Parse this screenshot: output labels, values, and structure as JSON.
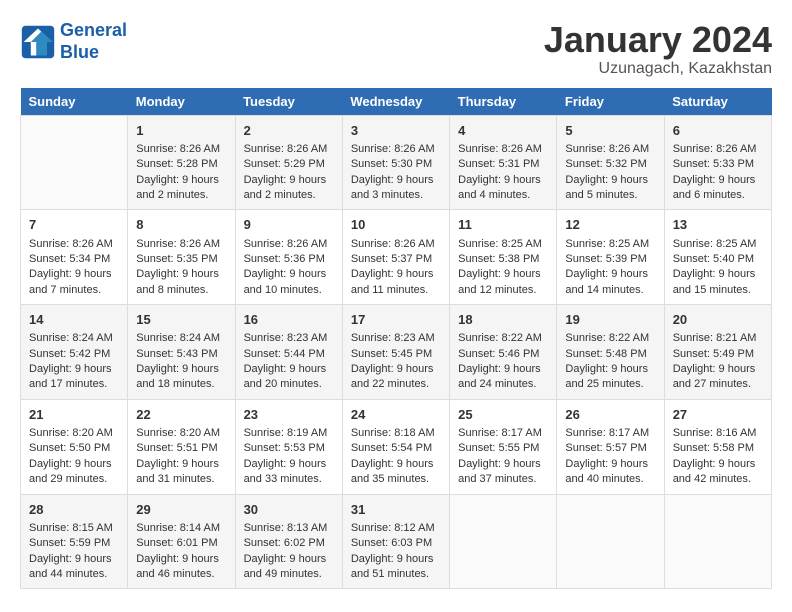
{
  "logo": {
    "line1": "General",
    "line2": "Blue"
  },
  "title": "January 2024",
  "subtitle": "Uzunagach, Kazakhstan",
  "days_header": [
    "Sunday",
    "Monday",
    "Tuesday",
    "Wednesday",
    "Thursday",
    "Friday",
    "Saturday"
  ],
  "weeks": [
    [
      {
        "day": "",
        "info": ""
      },
      {
        "day": "1",
        "info": "Sunrise: 8:26 AM\nSunset: 5:28 PM\nDaylight: 9 hours\nand 2 minutes."
      },
      {
        "day": "2",
        "info": "Sunrise: 8:26 AM\nSunset: 5:29 PM\nDaylight: 9 hours\nand 2 minutes."
      },
      {
        "day": "3",
        "info": "Sunrise: 8:26 AM\nSunset: 5:30 PM\nDaylight: 9 hours\nand 3 minutes."
      },
      {
        "day": "4",
        "info": "Sunrise: 8:26 AM\nSunset: 5:31 PM\nDaylight: 9 hours\nand 4 minutes."
      },
      {
        "day": "5",
        "info": "Sunrise: 8:26 AM\nSunset: 5:32 PM\nDaylight: 9 hours\nand 5 minutes."
      },
      {
        "day": "6",
        "info": "Sunrise: 8:26 AM\nSunset: 5:33 PM\nDaylight: 9 hours\nand 6 minutes."
      }
    ],
    [
      {
        "day": "7",
        "info": "Sunrise: 8:26 AM\nSunset: 5:34 PM\nDaylight: 9 hours\nand 7 minutes."
      },
      {
        "day": "8",
        "info": "Sunrise: 8:26 AM\nSunset: 5:35 PM\nDaylight: 9 hours\nand 8 minutes."
      },
      {
        "day": "9",
        "info": "Sunrise: 8:26 AM\nSunset: 5:36 PM\nDaylight: 9 hours\nand 10 minutes."
      },
      {
        "day": "10",
        "info": "Sunrise: 8:26 AM\nSunset: 5:37 PM\nDaylight: 9 hours\nand 11 minutes."
      },
      {
        "day": "11",
        "info": "Sunrise: 8:25 AM\nSunset: 5:38 PM\nDaylight: 9 hours\nand 12 minutes."
      },
      {
        "day": "12",
        "info": "Sunrise: 8:25 AM\nSunset: 5:39 PM\nDaylight: 9 hours\nand 14 minutes."
      },
      {
        "day": "13",
        "info": "Sunrise: 8:25 AM\nSunset: 5:40 PM\nDaylight: 9 hours\nand 15 minutes."
      }
    ],
    [
      {
        "day": "14",
        "info": "Sunrise: 8:24 AM\nSunset: 5:42 PM\nDaylight: 9 hours\nand 17 minutes."
      },
      {
        "day": "15",
        "info": "Sunrise: 8:24 AM\nSunset: 5:43 PM\nDaylight: 9 hours\nand 18 minutes."
      },
      {
        "day": "16",
        "info": "Sunrise: 8:23 AM\nSunset: 5:44 PM\nDaylight: 9 hours\nand 20 minutes."
      },
      {
        "day": "17",
        "info": "Sunrise: 8:23 AM\nSunset: 5:45 PM\nDaylight: 9 hours\nand 22 minutes."
      },
      {
        "day": "18",
        "info": "Sunrise: 8:22 AM\nSunset: 5:46 PM\nDaylight: 9 hours\nand 24 minutes."
      },
      {
        "day": "19",
        "info": "Sunrise: 8:22 AM\nSunset: 5:48 PM\nDaylight: 9 hours\nand 25 minutes."
      },
      {
        "day": "20",
        "info": "Sunrise: 8:21 AM\nSunset: 5:49 PM\nDaylight: 9 hours\nand 27 minutes."
      }
    ],
    [
      {
        "day": "21",
        "info": "Sunrise: 8:20 AM\nSunset: 5:50 PM\nDaylight: 9 hours\nand 29 minutes."
      },
      {
        "day": "22",
        "info": "Sunrise: 8:20 AM\nSunset: 5:51 PM\nDaylight: 9 hours\nand 31 minutes."
      },
      {
        "day": "23",
        "info": "Sunrise: 8:19 AM\nSunset: 5:53 PM\nDaylight: 9 hours\nand 33 minutes."
      },
      {
        "day": "24",
        "info": "Sunrise: 8:18 AM\nSunset: 5:54 PM\nDaylight: 9 hours\nand 35 minutes."
      },
      {
        "day": "25",
        "info": "Sunrise: 8:17 AM\nSunset: 5:55 PM\nDaylight: 9 hours\nand 37 minutes."
      },
      {
        "day": "26",
        "info": "Sunrise: 8:17 AM\nSunset: 5:57 PM\nDaylight: 9 hours\nand 40 minutes."
      },
      {
        "day": "27",
        "info": "Sunrise: 8:16 AM\nSunset: 5:58 PM\nDaylight: 9 hours\nand 42 minutes."
      }
    ],
    [
      {
        "day": "28",
        "info": "Sunrise: 8:15 AM\nSunset: 5:59 PM\nDaylight: 9 hours\nand 44 minutes."
      },
      {
        "day": "29",
        "info": "Sunrise: 8:14 AM\nSunset: 6:01 PM\nDaylight: 9 hours\nand 46 minutes."
      },
      {
        "day": "30",
        "info": "Sunrise: 8:13 AM\nSunset: 6:02 PM\nDaylight: 9 hours\nand 49 minutes."
      },
      {
        "day": "31",
        "info": "Sunrise: 8:12 AM\nSunset: 6:03 PM\nDaylight: 9 hours\nand 51 minutes."
      },
      {
        "day": "",
        "info": ""
      },
      {
        "day": "",
        "info": ""
      },
      {
        "day": "",
        "info": ""
      }
    ]
  ]
}
